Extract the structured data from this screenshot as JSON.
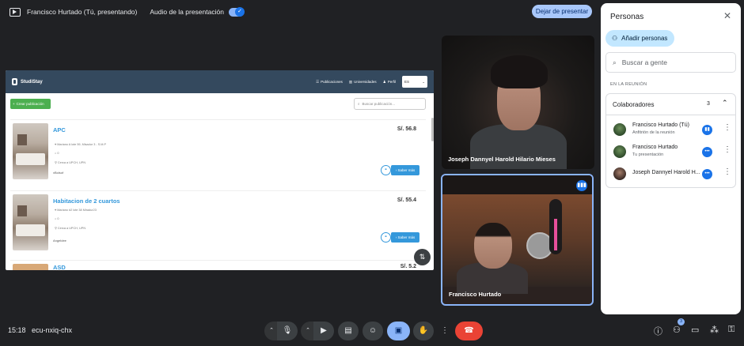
{
  "topbar": {
    "presenter": "Francisco Hurtado (Tú, presentando)",
    "audio_label": "Audio de la presentación",
    "stop_button": "Dejar de presentar"
  },
  "shared_screen": {
    "brand": "StudiStay",
    "nav": [
      "Publicaciones",
      "Universidades",
      "Perfil"
    ],
    "language": "ES",
    "create_button": "Crear publicación",
    "search_placeholder": "Buscar publicación...",
    "listings": [
      {
        "title": "APC",
        "price": "S/. 56.8",
        "address": "Mariano A lote 59, Misadur 3 - S.M.P",
        "rooms": "0",
        "near": "Cerca a UPCH, UPN",
        "owner": "vBolsof",
        "more": "Saber más"
      },
      {
        "title": "Habitacion de 2 cuartos",
        "price": "S/. 55.4",
        "address": "Mariano #2 lote 38 Miradur23",
        "rooms": "0",
        "near": "Cerca a UPCH, UPN",
        "owner": "Angeldee",
        "more": "Saber más"
      },
      {
        "title": "ASD",
        "price": "S/. 5.2"
      }
    ]
  },
  "participants": [
    {
      "name": "Joseph Dannyel Harold Hilario Mieses"
    },
    {
      "name": "Francisco Hurtado"
    }
  ],
  "people_panel": {
    "title": "Personas",
    "add_button": "Añadir personas",
    "search_placeholder": "Buscar a gente",
    "section_label": "EN LA REUNIÓN",
    "group_label": "Colaboradores",
    "group_count": "3",
    "people": [
      {
        "name": "Francisco Hurtado (Tú)",
        "role": "Anfitrión de la reunión"
      },
      {
        "name": "Francisco Hurtado",
        "role": "Tu presentación"
      },
      {
        "name": "Joseph Dannyel Harold H...",
        "role": ""
      }
    ]
  },
  "bottombar": {
    "time": "15:18",
    "meeting_code": "ecu-nxiq-chx",
    "participant_count": "3"
  },
  "colors": {
    "background": "#202124",
    "accent": "#8ab4f8",
    "end_call": "#ea4335"
  }
}
